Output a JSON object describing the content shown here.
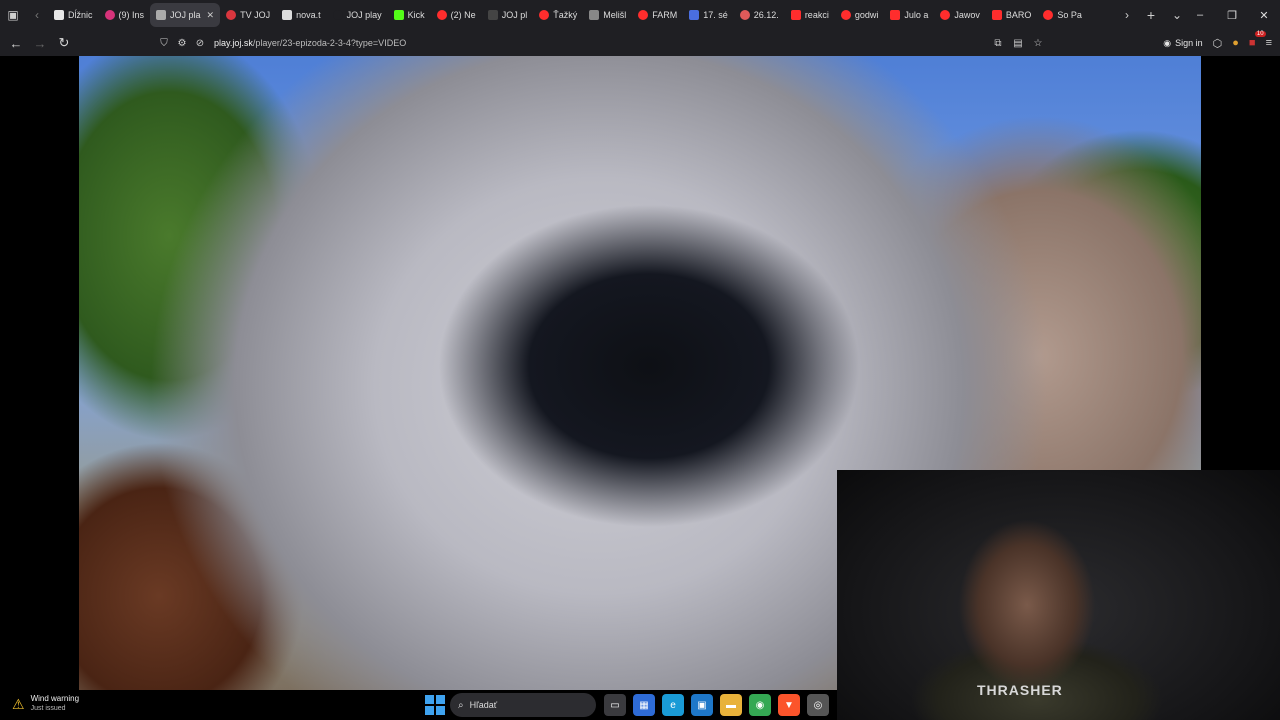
{
  "browser": {
    "tabs": [
      {
        "label": "Dĺžnic",
        "color": "#e8e8e8"
      },
      {
        "label": "(9) Ins",
        "color": "#d6337a"
      },
      {
        "label": "JOJ pla",
        "color": "#aaaaaa",
        "active": true
      },
      {
        "label": "TV JOJ",
        "color": "#d9363e"
      },
      {
        "label": "nova.t",
        "color": "#dddddd"
      },
      {
        "label": "JOJ play",
        "color": "#1f1f23"
      },
      {
        "label": "Kick",
        "color": "#53fc18"
      },
      {
        "label": "(2) Ne",
        "color": "#ff2d2d"
      },
      {
        "label": "JOJ pl",
        "color": "#444444"
      },
      {
        "label": "Ťažký",
        "color": "#ff2d2d"
      },
      {
        "label": "Melišl",
        "color": "#888888"
      },
      {
        "label": "FARM",
        "color": "#ff2d2d"
      },
      {
        "label": "17. sé",
        "color": "#4a6ee0"
      },
      {
        "label": "26.12.",
        "color": "#e05a5a"
      },
      {
        "label": "reakci",
        "color": "#ff2d2d"
      },
      {
        "label": "godwi",
        "color": "#ff2d2d"
      },
      {
        "label": "Julo a",
        "color": "#ff2d2d"
      },
      {
        "label": "Jawov",
        "color": "#ff2d2d"
      },
      {
        "label": "BARO",
        "color": "#ff2d2d"
      },
      {
        "label": "So Pa",
        "color": "#ff2d2d"
      }
    ],
    "url_domain": "play.joj.sk",
    "url_path": "/player/23-epizoda-2-3-4?type=VIDEO",
    "sign_in_label": "Sign in",
    "extension_badge": "10"
  },
  "webcam_overlay_text": "THRASHER",
  "taskbar": {
    "notification_title": "Wind warning",
    "notification_subtitle": "Just issued",
    "search_placeholder": "Hľadať",
    "apps": [
      {
        "icon": "task-view-icon",
        "glyph": "▭",
        "color": "#3a3a3e"
      },
      {
        "icon": "store-icon",
        "glyph": "▦",
        "color": "#2e6bd6"
      },
      {
        "icon": "edge-icon",
        "glyph": "e",
        "color": "#1a9bd6"
      },
      {
        "icon": "desktop-icon",
        "glyph": "▣",
        "color": "#1e77c8"
      },
      {
        "icon": "folder-icon",
        "glyph": "▬",
        "color": "#e8b23a"
      },
      {
        "icon": "chrome-icon",
        "glyph": "◉",
        "color": "#34a853"
      },
      {
        "icon": "brave-icon",
        "glyph": "▼",
        "color": "#fb542b"
      },
      {
        "icon": "obs-icon",
        "glyph": "◎",
        "color": "#555555"
      }
    ]
  }
}
